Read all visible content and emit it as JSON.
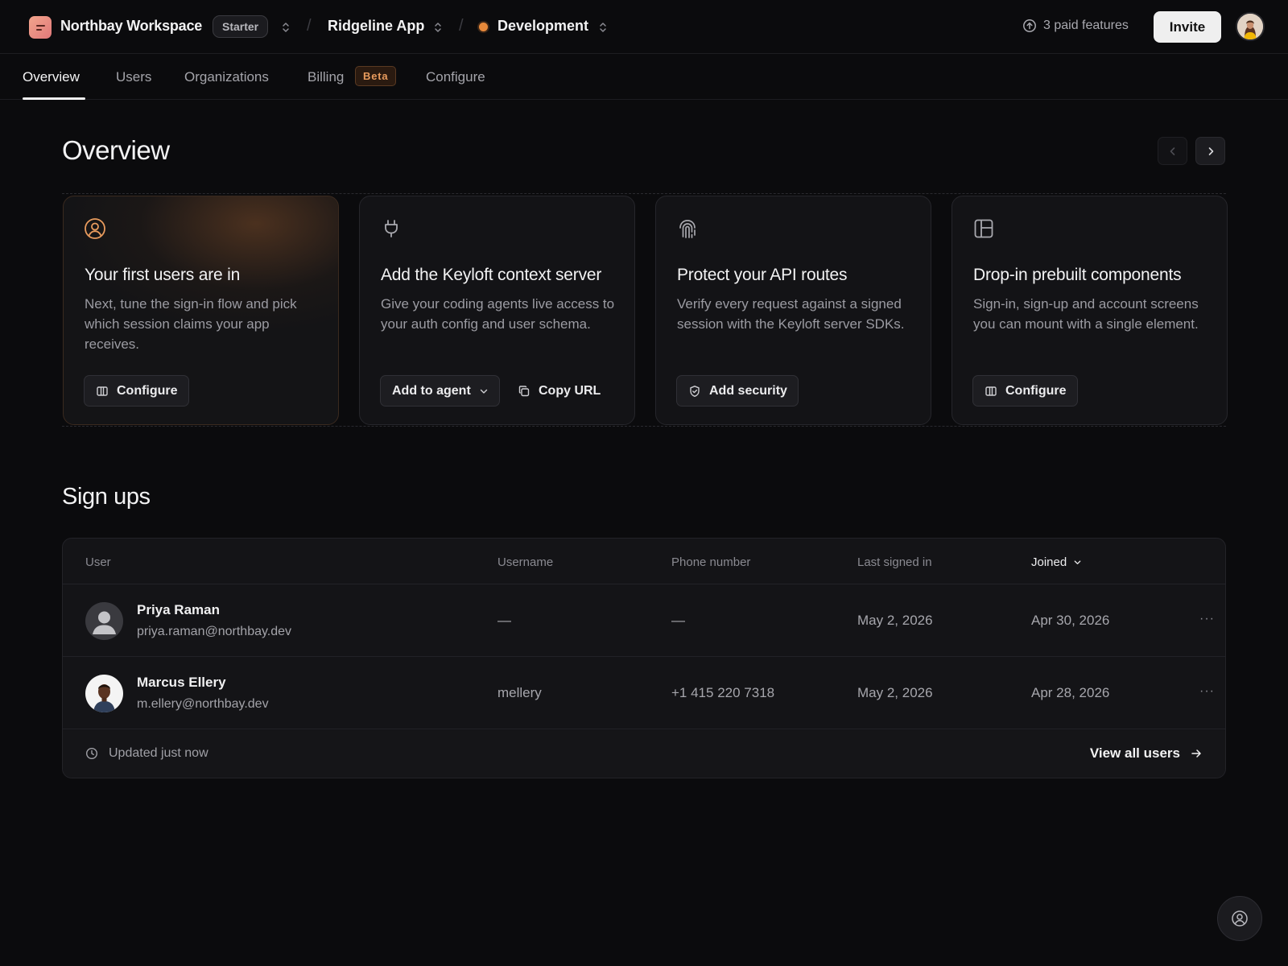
{
  "topbar": {
    "workspace_name": "Northbay Workspace",
    "plan": "Starter",
    "separator": "/",
    "app_name": "Ridgeline App",
    "environment": "Development",
    "environment_color": "#e8893a",
    "paid_features": "3 paid features",
    "invite_label": "Invite"
  },
  "tabs": [
    {
      "label": "Overview",
      "active": true
    },
    {
      "label": "Users"
    },
    {
      "label": "Organizations"
    },
    {
      "label": "Billing",
      "badge": "Beta"
    },
    {
      "label": "Configure"
    }
  ],
  "overview": {
    "title": "Overview",
    "cards": [
      {
        "icon": "user-circle-icon",
        "title": "Your first users are in",
        "description": "Next, tune the sign-in flow and pick which session claims your app receives.",
        "button": "Configure",
        "button_icon": "columns-icon"
      },
      {
        "icon": "plug-icon",
        "title": "Add the Keyloft context server",
        "description": "Give your coding agents live access to your auth config and user schema.",
        "button": "Add to agent",
        "button_icon": "chevron-down-icon",
        "secondary_button": "Copy URL",
        "secondary_icon": "copy-icon"
      },
      {
        "icon": "fingerprint-icon",
        "title": "Protect your API routes",
        "description": "Verify every request against a signed session with the Keyloft server SDKs.",
        "button": "Add security",
        "button_icon": "shield-icon"
      },
      {
        "icon": "layout-icon",
        "title": "Drop-in prebuilt components",
        "description": "Sign-in, sign-up and account screens you can mount with a single element.",
        "button": "Configure",
        "button_icon": "columns-icon"
      }
    ]
  },
  "signups": {
    "title": "Sign ups",
    "columns": [
      "User",
      "Username",
      "Phone number",
      "Last signed in",
      "Joined"
    ],
    "sorted_column": "Joined",
    "rows": [
      {
        "name": "Priya Raman",
        "email": "priya.raman@northbay.dev",
        "username": "—",
        "phone": "—",
        "last_signed_in": "May 2, 2026",
        "joined": "Apr 30, 2026",
        "avatar": "default-avatar-icon"
      },
      {
        "name": "Marcus Ellery",
        "email": "m.ellery@northbay.dev",
        "username": "mellery",
        "phone": "+1 415 220 7318",
        "last_signed_in": "May 2, 2026",
        "joined": "Apr 28, 2026",
        "avatar": "photo-avatar"
      }
    ],
    "more_label": "···",
    "updated": "Updated just now",
    "view_all": "View all users"
  },
  "colors": {
    "background": "#0b0b0d",
    "accent": "#e8893a",
    "beta_badge": "#e89b5d"
  }
}
